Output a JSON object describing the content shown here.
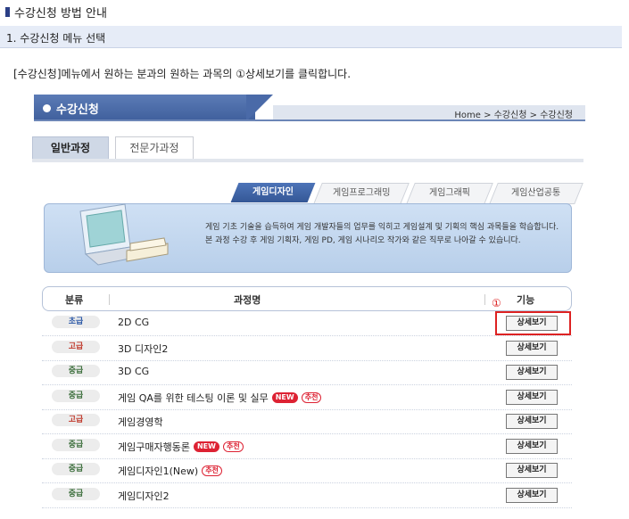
{
  "page": {
    "title": "수강신청 방법 안내"
  },
  "section": {
    "title": "1. 수강신청 메뉴 선택"
  },
  "instruction": "[수강신청]메뉴에서 원하는 분과의 원하는 과목의 ①상세보기를 클릭합니다.",
  "banner": {
    "title": "수강신청",
    "breadcrumb": "Home > 수강신청 > 수강신청"
  },
  "primary_tabs": [
    "일반과정",
    "전문가과정"
  ],
  "sub_tabs": [
    "게임디자인",
    "게임프로그래밍",
    "게임그래픽",
    "게임산업공통"
  ],
  "promo": {
    "line1": "게임 기초 기술을 습득하여 게임 개발자들의 업무를 익히고 게임설계 및 기획의 핵심 과목들을 학습합니다.",
    "line2": "본 과정 수강 후 게임 기획자, 게임 PD, 게임 시나리오 작가와 같은 직무로 나아갈 수 있습니다."
  },
  "table": {
    "headers": {
      "category": "분류",
      "course": "과정명",
      "action": "기능"
    },
    "action_label": "상세보기",
    "callout": "①",
    "rows": [
      {
        "level": "초급",
        "name": "2D CG",
        "tags": []
      },
      {
        "level": "고급",
        "name": "3D 디자인2",
        "tags": []
      },
      {
        "level": "중급",
        "name": "3D CG",
        "tags": []
      },
      {
        "level": "중급",
        "name": "게임 QA를 위한 테스팅 이론 및 실무",
        "tags": [
          "NEW",
          "추천"
        ]
      },
      {
        "level": "고급",
        "name": "게임경영학",
        "tags": []
      },
      {
        "level": "중급",
        "name": "게임구매자행동론",
        "tags": [
          "NEW",
          "추천"
        ]
      },
      {
        "level": "중급",
        "name": "게임디자인1(New)",
        "tags": [
          "추천"
        ]
      },
      {
        "level": "중급",
        "name": "게임디자인2",
        "tags": []
      }
    ]
  },
  "colors": {
    "accent": "#3f5f9c",
    "highlight": "#dd2222",
    "level_basic": "#2a57a6",
    "level_advanced": "#c0392b",
    "level_mid": "#3b6e3b"
  }
}
